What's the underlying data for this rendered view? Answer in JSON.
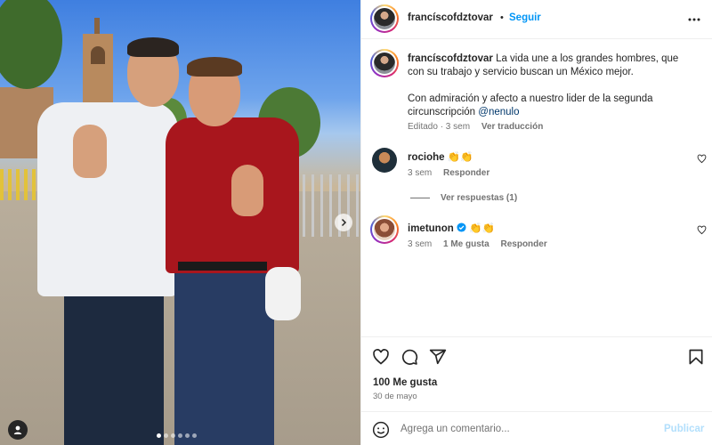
{
  "post": {
    "username": "francíscofdztovar",
    "follow_label": "Seguir",
    "header_separator": "•",
    "caption": {
      "username": "francíscofdztovar",
      "line1": "La vida une a los grandes hombres, que con su trabajo y servicio buscan un México mejor.",
      "line2": "Con admiración y afecto a nuestro lider de la segunda circunscripción",
      "mention": "@nenulo"
    },
    "caption_meta": {
      "edited": "Editado · 3 sem",
      "translate": "Ver traducción"
    },
    "comments": [
      {
        "username": "rociohe",
        "text": "👏👏",
        "time": "3 sem",
        "reply_label": "Responder",
        "view_replies": "Ver respuestas (1)"
      },
      {
        "username": "imetunon",
        "text": "👏👏",
        "time": "3 sem",
        "likes_label": "1 Me gusta",
        "reply_label": "Responder"
      }
    ],
    "likes": "100 Me gusta",
    "date": "30 de mayo",
    "composer": {
      "placeholder": "Agrega un comentario...",
      "publish_label": "Publicar"
    }
  },
  "carousel": {
    "total_slides": 6,
    "active_slide": 1
  },
  "icons": {
    "more": "more-options-icon",
    "like": "heart-icon",
    "comment": "comment-icon",
    "share": "share-icon",
    "save": "bookmark-icon",
    "emoji": "emoji-icon",
    "verified": "verified-badge-icon",
    "next": "chevron-right-icon",
    "tags": "user-tag-icon"
  },
  "colors": {
    "accent": "#0095f6",
    "link": "#00376b",
    "muted": "#737373",
    "publish_disabled": "#b2dffc"
  }
}
